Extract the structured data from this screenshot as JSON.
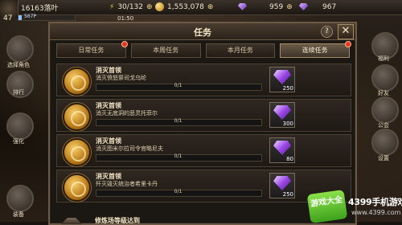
{
  "hud": {
    "player_name": "16163落叶",
    "level": "47",
    "xp_text": "567P",
    "stamina": "30/132",
    "timer": "01:50",
    "gold": "1,553,078",
    "gems_a": "959",
    "gems_b": "967"
  },
  "side_left": [
    {
      "label": "选择角色"
    },
    {
      "label": "排行"
    },
    {
      "label": "强化"
    },
    {
      "label": "装备"
    }
  ],
  "side_right": [
    {
      "label": "福利"
    },
    {
      "label": "好友"
    },
    {
      "label": "公会"
    },
    {
      "label": "设置"
    }
  ],
  "dialog": {
    "title": "任务",
    "help_label": "?",
    "close_label": "✕",
    "tabs": [
      {
        "label": "日常任务",
        "active": false,
        "dot": true
      },
      {
        "label": "本周任务",
        "active": false,
        "dot": false
      },
      {
        "label": "本月任务",
        "active": false,
        "dot": false
      },
      {
        "label": "连续任务",
        "active": true,
        "dot": true
      }
    ],
    "quests": [
      {
        "title": "消灭首领",
        "desc": "消灭愤怒祭司戈乌纶",
        "progress": "0/1",
        "progress_value": 0,
        "reward": "250"
      },
      {
        "title": "消灭首领",
        "desc": "消灭无底洞的恶灵托菲尔",
        "progress": "0/1",
        "progress_value": 0,
        "reward": "300"
      },
      {
        "title": "消灭首领",
        "desc": "消灭图米尔拉司令官略尼夫",
        "progress": "0/1",
        "progress_value": 0,
        "reward": "80"
      },
      {
        "title": "消灭首领",
        "desc": "歼灭毁灭统治者希里卡丹",
        "progress": "0/1",
        "progress_value": 0,
        "reward": "250"
      }
    ],
    "footer_text": "修炼场等级达到"
  },
  "watermark": {
    "badge_text": "游戏大全",
    "brand": "4399手机游戏网",
    "url": "www.4399.com"
  },
  "colors": {
    "accent_gold": "#f7cf6a",
    "gem_purple": "#9b48e6",
    "watermark_green": "#5bc22a"
  }
}
